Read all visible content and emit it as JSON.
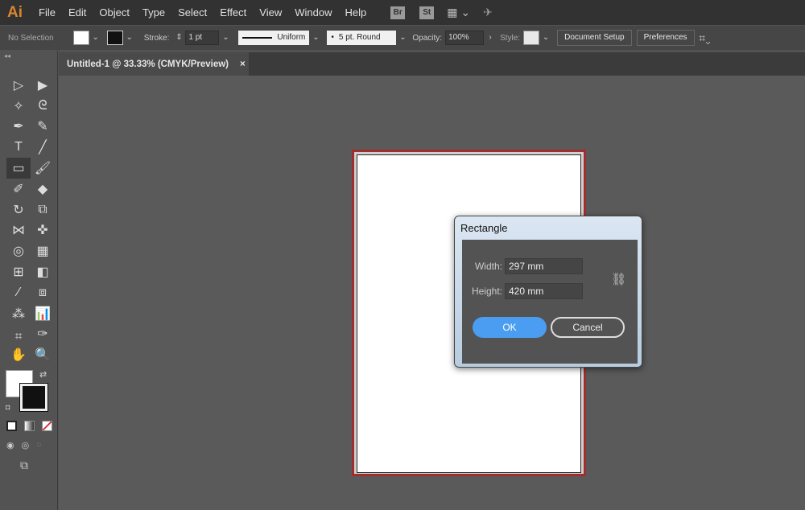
{
  "app": {
    "logo": "Ai"
  },
  "menu": [
    "File",
    "Edit",
    "Object",
    "Type",
    "Select",
    "Effect",
    "View",
    "Window",
    "Help"
  ],
  "menubar_icons": [
    {
      "name": "bridge-icon",
      "label": "Br"
    },
    {
      "name": "stock-icon",
      "label": "St"
    }
  ],
  "control": {
    "selection": "No Selection",
    "stroke_label": "Stroke:",
    "stroke_value": "1 pt",
    "profile": "Uniform",
    "brush": "5 pt. Round",
    "opacity_label": "Opacity:",
    "opacity_value": "100%",
    "style_label": "Style:",
    "document_setup": "Document Setup",
    "preferences": "Preferences"
  },
  "tab": {
    "title": "Untitled-1 @ 33.33% (CMYK/Preview)",
    "close": "×"
  },
  "tools": [
    {
      "name": "selection-tool",
      "glyph": "▷"
    },
    {
      "name": "direct-selection-tool",
      "glyph": "▶"
    },
    {
      "name": "magic-wand-tool",
      "glyph": "✧"
    },
    {
      "name": "lasso-tool",
      "glyph": "ᘓ"
    },
    {
      "name": "pen-tool",
      "glyph": "✒"
    },
    {
      "name": "curvature-tool",
      "glyph": "✎"
    },
    {
      "name": "type-tool",
      "glyph": "T"
    },
    {
      "name": "line-tool",
      "glyph": "╱"
    },
    {
      "name": "rectangle-tool",
      "glyph": "▭"
    },
    {
      "name": "paintbrush-tool",
      "glyph": "🖌"
    },
    {
      "name": "shaper-tool",
      "glyph": "✐"
    },
    {
      "name": "eraser-tool",
      "glyph": "◆"
    },
    {
      "name": "rotate-tool",
      "glyph": "↻"
    },
    {
      "name": "scale-tool",
      "glyph": "⧉"
    },
    {
      "name": "width-tool",
      "glyph": "⋈"
    },
    {
      "name": "puppet-warp-tool",
      "glyph": "✜"
    },
    {
      "name": "shape-builder-tool",
      "glyph": "◎"
    },
    {
      "name": "perspective-grid-tool",
      "glyph": "▦"
    },
    {
      "name": "mesh-tool",
      "glyph": "⊞"
    },
    {
      "name": "gradient-tool",
      "glyph": "◧"
    },
    {
      "name": "eyedropper-tool",
      "glyph": "⁄"
    },
    {
      "name": "blend-tool",
      "glyph": "⧈"
    },
    {
      "name": "symbol-sprayer-tool",
      "glyph": "⁂"
    },
    {
      "name": "column-graph-tool",
      "glyph": "📊"
    },
    {
      "name": "artboard-tool",
      "glyph": "⌗"
    },
    {
      "name": "slice-tool",
      "glyph": "✑"
    },
    {
      "name": "hand-tool",
      "glyph": "✋"
    },
    {
      "name": "zoom-tool",
      "glyph": "🔍"
    }
  ],
  "dialog": {
    "title": "Rectangle",
    "width_label": "Width:",
    "width_value": "297 mm",
    "height_label": "Height:",
    "height_value": "420 mm",
    "ok": "OK",
    "cancel": "Cancel"
  },
  "colors": {
    "accent": "#4a9df0",
    "artboard_outline": "#9e2f2f",
    "logo": "#d8862e"
  }
}
